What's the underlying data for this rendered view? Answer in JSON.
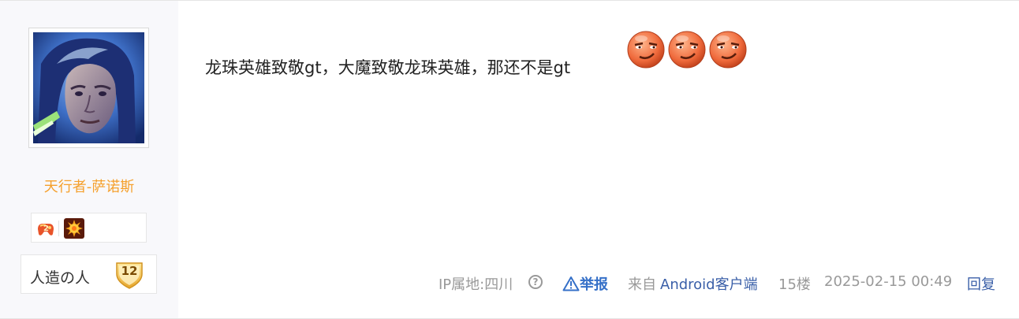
{
  "user": {
    "username": "天行者-萨诺斯",
    "badges": [
      "game-badge-icon",
      "sun-badge-icon"
    ],
    "badge_game_number": "2",
    "level_name": "人造の人",
    "level": "12"
  },
  "post": {
    "text": "龙珠英雄致敬gt，大魔致敬龙珠英雄，那还不是gt",
    "emojis": [
      "smirk-emoji-icon",
      "smirk-emoji-icon",
      "smirk-emoji-icon"
    ]
  },
  "footer": {
    "ip_label": "IP属地:四川",
    "help_symbol": "?",
    "report_label": "举报",
    "source_prefix": "来自",
    "source_link": "Android客户端",
    "floor": "15楼",
    "datetime": "2025-02-15 00:49",
    "reply_label": "回复"
  },
  "colors": {
    "username": "#f5a02c",
    "link": "#3a5fa8",
    "report": "#3570c8",
    "meta": "#999999"
  }
}
